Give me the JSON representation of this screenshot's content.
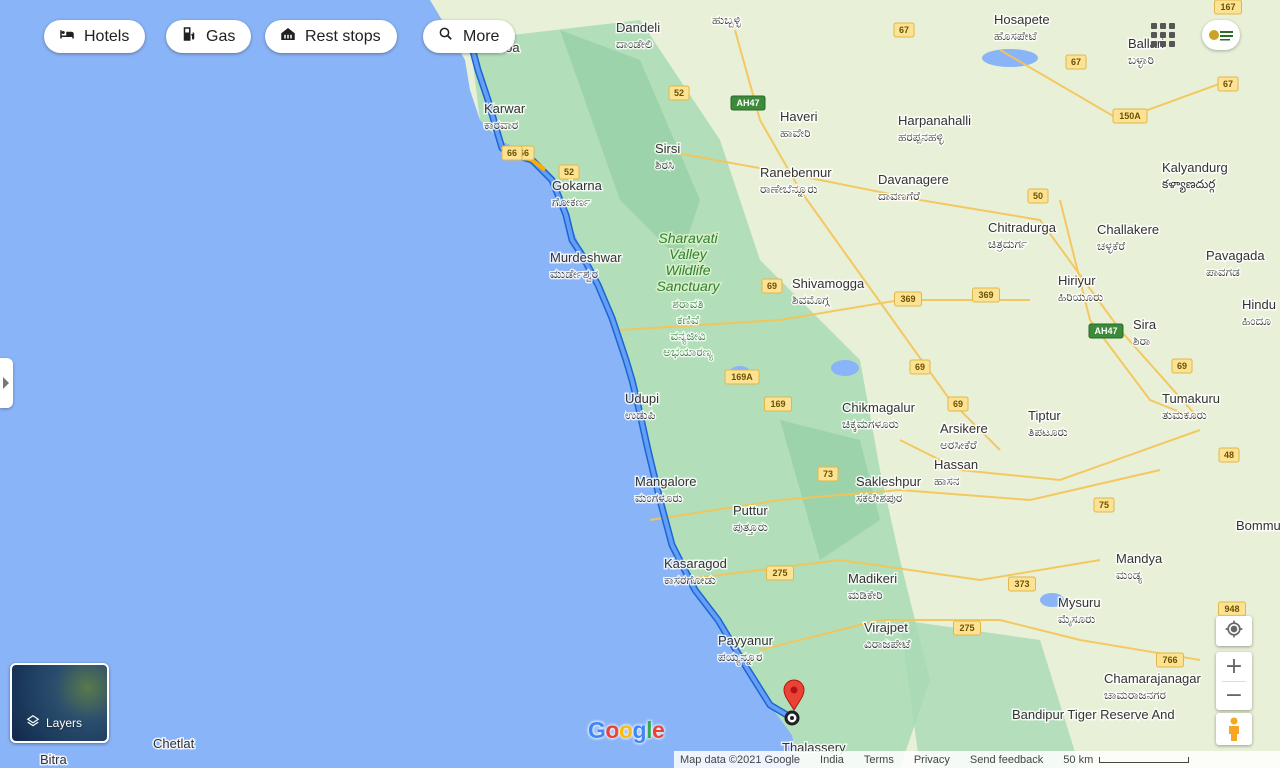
{
  "toolbar": {
    "hotels_label": "Hotels",
    "gas_label": "Gas",
    "rest_label": "Rest stops",
    "more_label": "More"
  },
  "layers": {
    "label": "Layers"
  },
  "map": {
    "cities": [
      {
        "name": "Goa",
        "local": ""
      },
      {
        "name": "Dandeli",
        "local": "ದಾಂಡೇಲಿ"
      },
      {
        "name": "",
        "local": "ಹುಬ್ಬಳ್ಳಿ"
      },
      {
        "name": "Hosapete",
        "local": "ಹೊಸಪೇಟೆ"
      },
      {
        "name": "Ballari",
        "local": "ಬಳ್ಳಾರಿ"
      },
      {
        "name": "Karwar",
        "local": "ಕಾರವಾರ"
      },
      {
        "name": "Haveri",
        "local": "ಹಾವೇರಿ"
      },
      {
        "name": "Harpanahalli",
        "local": "ಹರಪ್ಪನಹಳ್ಳಿ"
      },
      {
        "name": "Sirsi",
        "local": "ಶಿರಸಿ"
      },
      {
        "name": "Ranebennur",
        "local": "ರಾಣೇಬೆನ್ನೂರು"
      },
      {
        "name": "Davanagere",
        "local": "ದಾವಣಗೆರೆ"
      },
      {
        "name": "Kalyandurg",
        "local": "కళ్యాణదుర్గ"
      },
      {
        "name": "Gokarna",
        "local": "ಗೋಕರ್ಣ"
      },
      {
        "name": "Chitradurga",
        "local": "ಚಿತ್ರದುರ್ಗ"
      },
      {
        "name": "Challakere",
        "local": "ಚಳ್ಳಕೆರೆ"
      },
      {
        "name": "Pavagada",
        "local": "ಪಾವಗಡ"
      },
      {
        "name": "Murdeshwar",
        "local": "ಮುರ್ಡೇಶ್ವರ"
      },
      {
        "name": "Shivamogga",
        "local": "ಶಿವಮೊಗ್ಗ"
      },
      {
        "name": "Hiriyur",
        "local": "ಹಿರಿಯೂರು"
      },
      {
        "name": "Hindu",
        "local": "ಹಿಂದೂ"
      },
      {
        "name": "Sira",
        "local": "ಶಿರಾ"
      },
      {
        "name": "Udupi",
        "local": "ಉಡುಪಿ"
      },
      {
        "name": "Chikmagalur",
        "local": "ಚಿಕ್ಕಮಗಳೂರು"
      },
      {
        "name": "Arsikere",
        "local": "ಅರಸೀಕೆರೆ"
      },
      {
        "name": "Tiptur",
        "local": "ತಿಪಟೂರು"
      },
      {
        "name": "Tumakuru",
        "local": "ತುಮಕೂರು"
      },
      {
        "name": "Mangalore",
        "local": "ಮಂಗಳೂರು"
      },
      {
        "name": "Hassan",
        "local": "ಹಾಸನ"
      },
      {
        "name": "Sakleshpur",
        "local": "ಸಕಲೇಶಪುರ"
      },
      {
        "name": "Puttur",
        "local": "ಪುತ್ತೂರು"
      },
      {
        "name": "Kasaragod",
        "local": "ಕಾಸರಗೋಡು"
      },
      {
        "name": "Madikeri",
        "local": "ಮಡಿಕೇರಿ"
      },
      {
        "name": "Mandya",
        "local": "ಮಂಡ್ಯ"
      },
      {
        "name": "Mysuru",
        "local": "ಮೈಸೂರು"
      },
      {
        "name": "Payyanur",
        "local": "ಪಯ್ಯನ್ನೂರ"
      },
      {
        "name": "Virajpet",
        "local": "ವಿರಾಜಪೇಟೆ"
      },
      {
        "name": "Chamarajanagar",
        "local": "ಚಾಮರಾಜನಗರ"
      },
      {
        "name": "Bandipur Tiger Reserve And",
        "local": ""
      },
      {
        "name": "Chetlat",
        "local": ""
      },
      {
        "name": "Bitra",
        "local": ""
      },
      {
        "name": "Thalassery",
        "local": ""
      },
      {
        "name": "Bommu",
        "local": ""
      }
    ],
    "park_label_lines": [
      "Sharavati",
      "Valley",
      "Wildlife",
      "Sanctuary"
    ],
    "park_local_lines": [
      "ಶರಾವತಿ",
      "ಕಣಿವೆ",
      "ವನ್ಯಜೀವಿ",
      "ಅಭಯಾರಣ್ಯ"
    ],
    "road_shields": [
      "67",
      "67",
      "67",
      "52",
      "AH47",
      "150A",
      "66",
      "52",
      "50",
      "69",
      "369",
      "369",
      "AH47",
      "69",
      "69",
      "169A",
      "169",
      "69",
      "48",
      "73",
      "75",
      "275",
      "275",
      "373",
      "948",
      "766",
      "167",
      "66"
    ]
  },
  "footer": {
    "map_data": "Map data ©2021 Google",
    "region": "India",
    "terms": "Terms",
    "privacy": "Privacy",
    "feedback": "Send feedback",
    "scale": "50 km"
  },
  "colors": {
    "water": "#8ab4f8",
    "route": "#4285f4",
    "route_traffic": "#f9ab00",
    "destination_pin": "#ea4335",
    "forest": "#a8dab5",
    "land": "#e8f0d8"
  },
  "icons": [
    "bed-icon",
    "gas-station-icon",
    "rest-stop-icon",
    "search-icon",
    "layers-icon",
    "my-location-icon",
    "zoom-in-icon",
    "zoom-out-icon",
    "pegman-icon",
    "apps-grid-icon",
    "destination-pin-icon",
    "origin-marker-icon"
  ]
}
